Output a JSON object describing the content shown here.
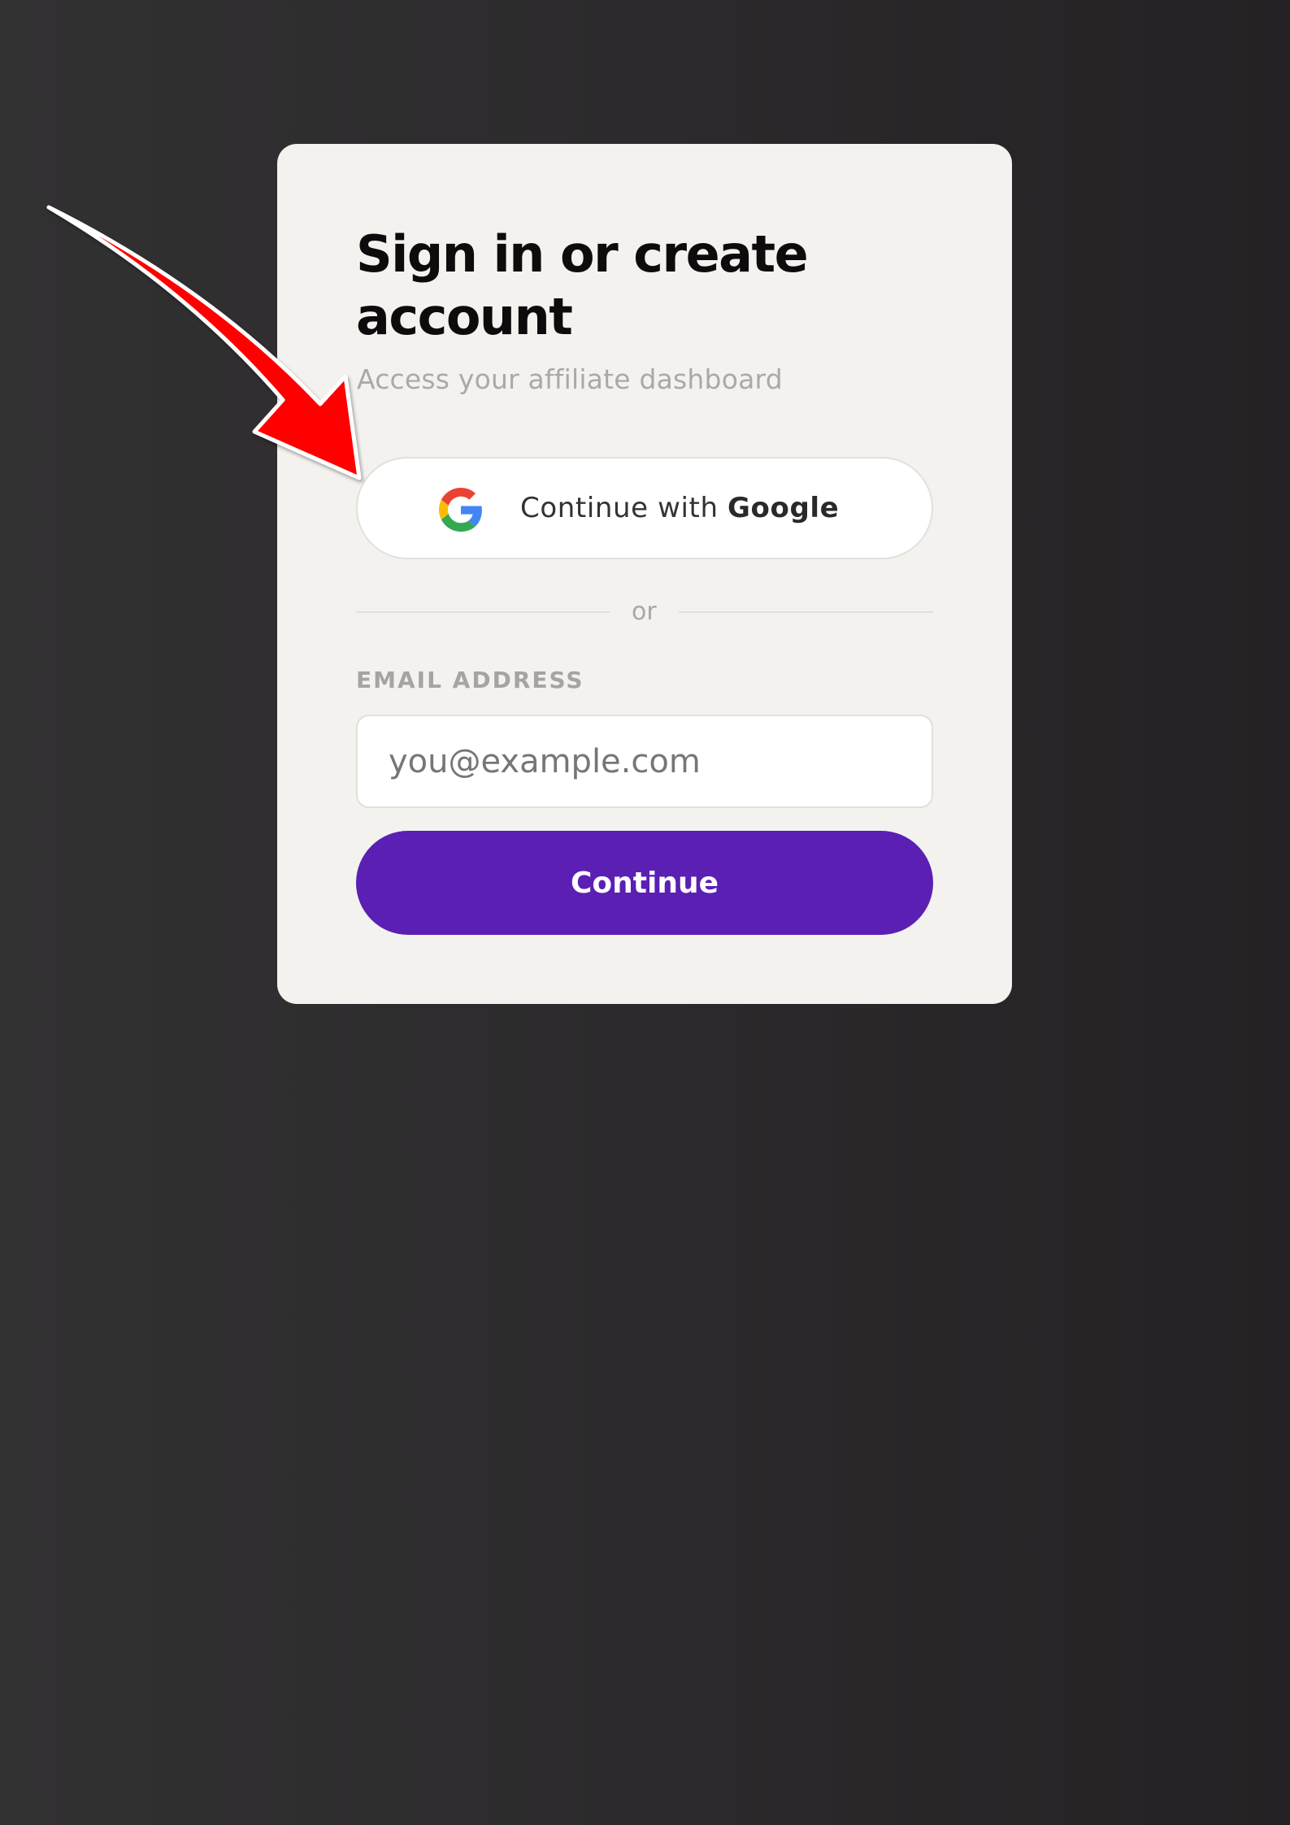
{
  "auth": {
    "title": "Sign in or create account",
    "subtitle": "Access your affiliate dashboard",
    "google_button": {
      "prefix": "Continue with ",
      "brand": "Google"
    },
    "divider_text": "or",
    "email": {
      "label": "EMAIL ADDRESS",
      "placeholder": "you@example.com",
      "value": ""
    },
    "continue_label": "Continue"
  },
  "colors": {
    "accent": "#5b1fb4",
    "background": "#2c2a2c",
    "card": "#f3f2ef",
    "annotation_arrow": "#ff0000"
  },
  "icons": {
    "google": "google-g-icon",
    "annotation": "red-arrow-icon"
  }
}
